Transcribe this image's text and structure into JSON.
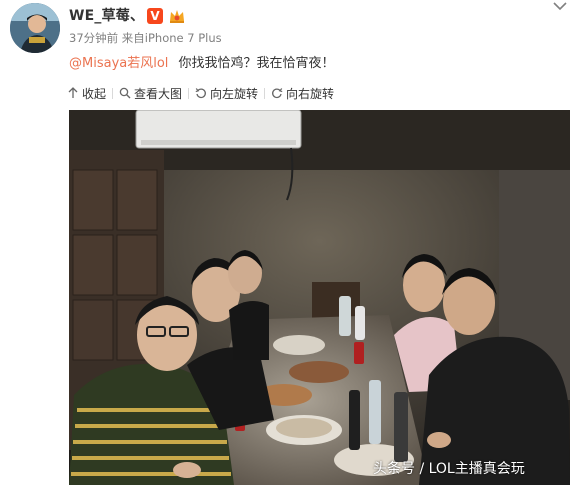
{
  "post": {
    "author": "WE_草莓、",
    "vip_badge": "V",
    "meta": "37分钟前 来自iPhone 7 Plus",
    "mention": "@Misaya若风lol",
    "text": "你找我恰鸡？我在恰宵夜！"
  },
  "toolbar": {
    "collapse": "收起",
    "view_large": "查看大图",
    "rotate_left": "向左旋转",
    "rotate_right": "向右旋转"
  },
  "photo": {
    "watermark": "头条号 / LOL主播真会玩"
  },
  "icons": {
    "collapse": "arrow-up-icon",
    "view_large": "magnifier-icon",
    "rotate_left": "rotate-left-icon",
    "rotate_right": "rotate-right-icon",
    "more": "chevron-down-icon"
  },
  "colors": {
    "mention": "#eb7350",
    "vip_badge": "#f7471c",
    "meta_text": "#808080"
  }
}
